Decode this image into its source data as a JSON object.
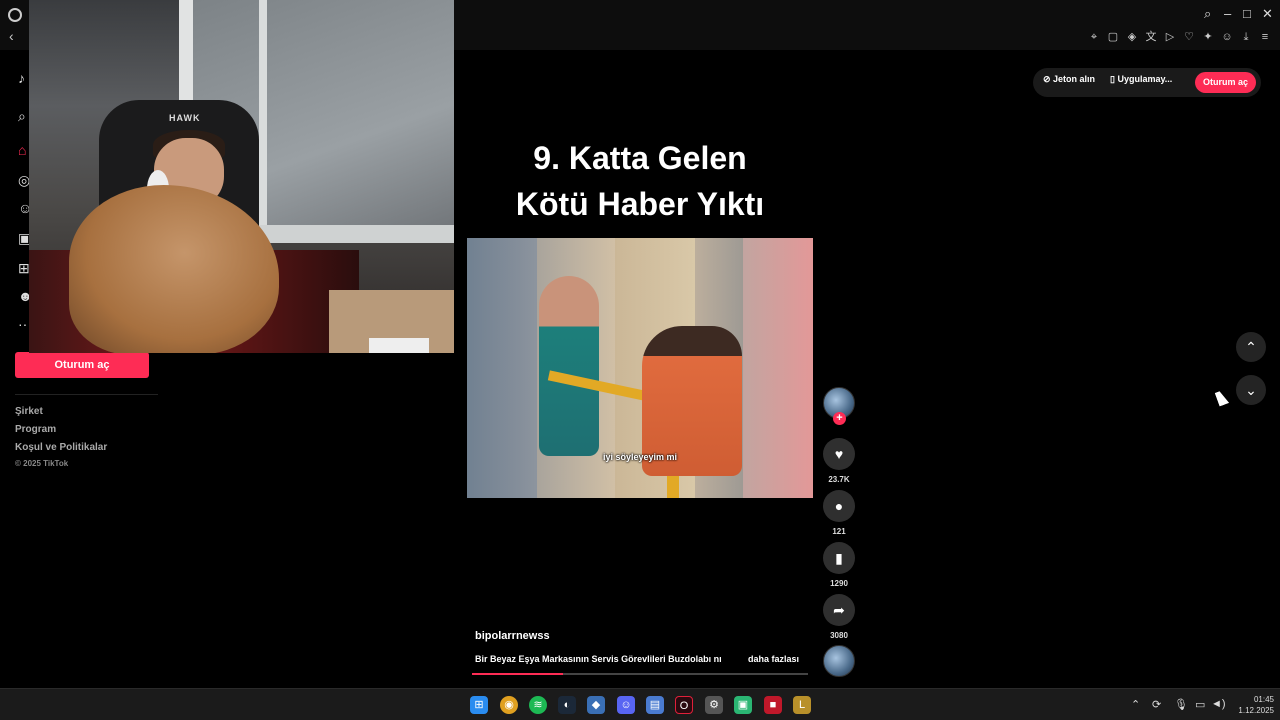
{
  "browser": {
    "back_icon": "chevron-left-icon",
    "window_controls": [
      "search-icon",
      "minimize-icon",
      "maximize-icon",
      "close-icon"
    ],
    "toolbar_icons": [
      "pin-icon",
      "bookmark-icon",
      "shield-icon",
      "translate-icon",
      "play-icon",
      "heart-icon",
      "puzzle-icon",
      "profile-icon",
      "download-icon",
      "menu-icon"
    ]
  },
  "sidebar": {
    "icons": [
      "tiktok-logo-icon",
      "search-icon",
      "home-icon",
      "explore-icon",
      "following-icon",
      "live-icon",
      "upload-icon",
      "profile-icon",
      "more-icon"
    ],
    "signin_label": "Oturum aç",
    "footer": [
      "Şirket",
      "Program",
      "Koşul ve Politikalar"
    ],
    "copyright": "© 2025 TikTok"
  },
  "webcam": {
    "chair_label": "HAWK"
  },
  "video": {
    "title_line1": "9. Katta Gelen",
    "title_line2": "Kötü Haber Yıktı",
    "caption": "iyi söyleyeyim mi",
    "author": "bipolarrnewss",
    "description": "Bir Beyaz Eşya Markasının Servis Görevlileri Buzdolabı nı",
    "more_label": "daha fazlası",
    "progress_percent": 27
  },
  "actions": {
    "like_count": "23.7K",
    "comment_count": "121",
    "bookmark_count": "1290",
    "share_count": "3080",
    "icons": [
      "heart-icon",
      "comment-icon",
      "bookmark-icon",
      "share-icon"
    ]
  },
  "header": {
    "coins_label": "Jeton alın",
    "app_label": "Uygulamay...",
    "signin_label": "Oturum aç"
  },
  "taskbar": {
    "apps": [
      "windows-start-icon",
      "chrome-icon",
      "spotify-icon",
      "steam-icon",
      "app-icon",
      "discord-icon",
      "notepad-icon",
      "opera-icon",
      "settings-icon",
      "app-icon",
      "app-icon",
      "league-icon"
    ],
    "time": "01:45",
    "date": "1.12.2025"
  },
  "colors": {
    "accent": "#fe2c55",
    "background": "#000000"
  }
}
